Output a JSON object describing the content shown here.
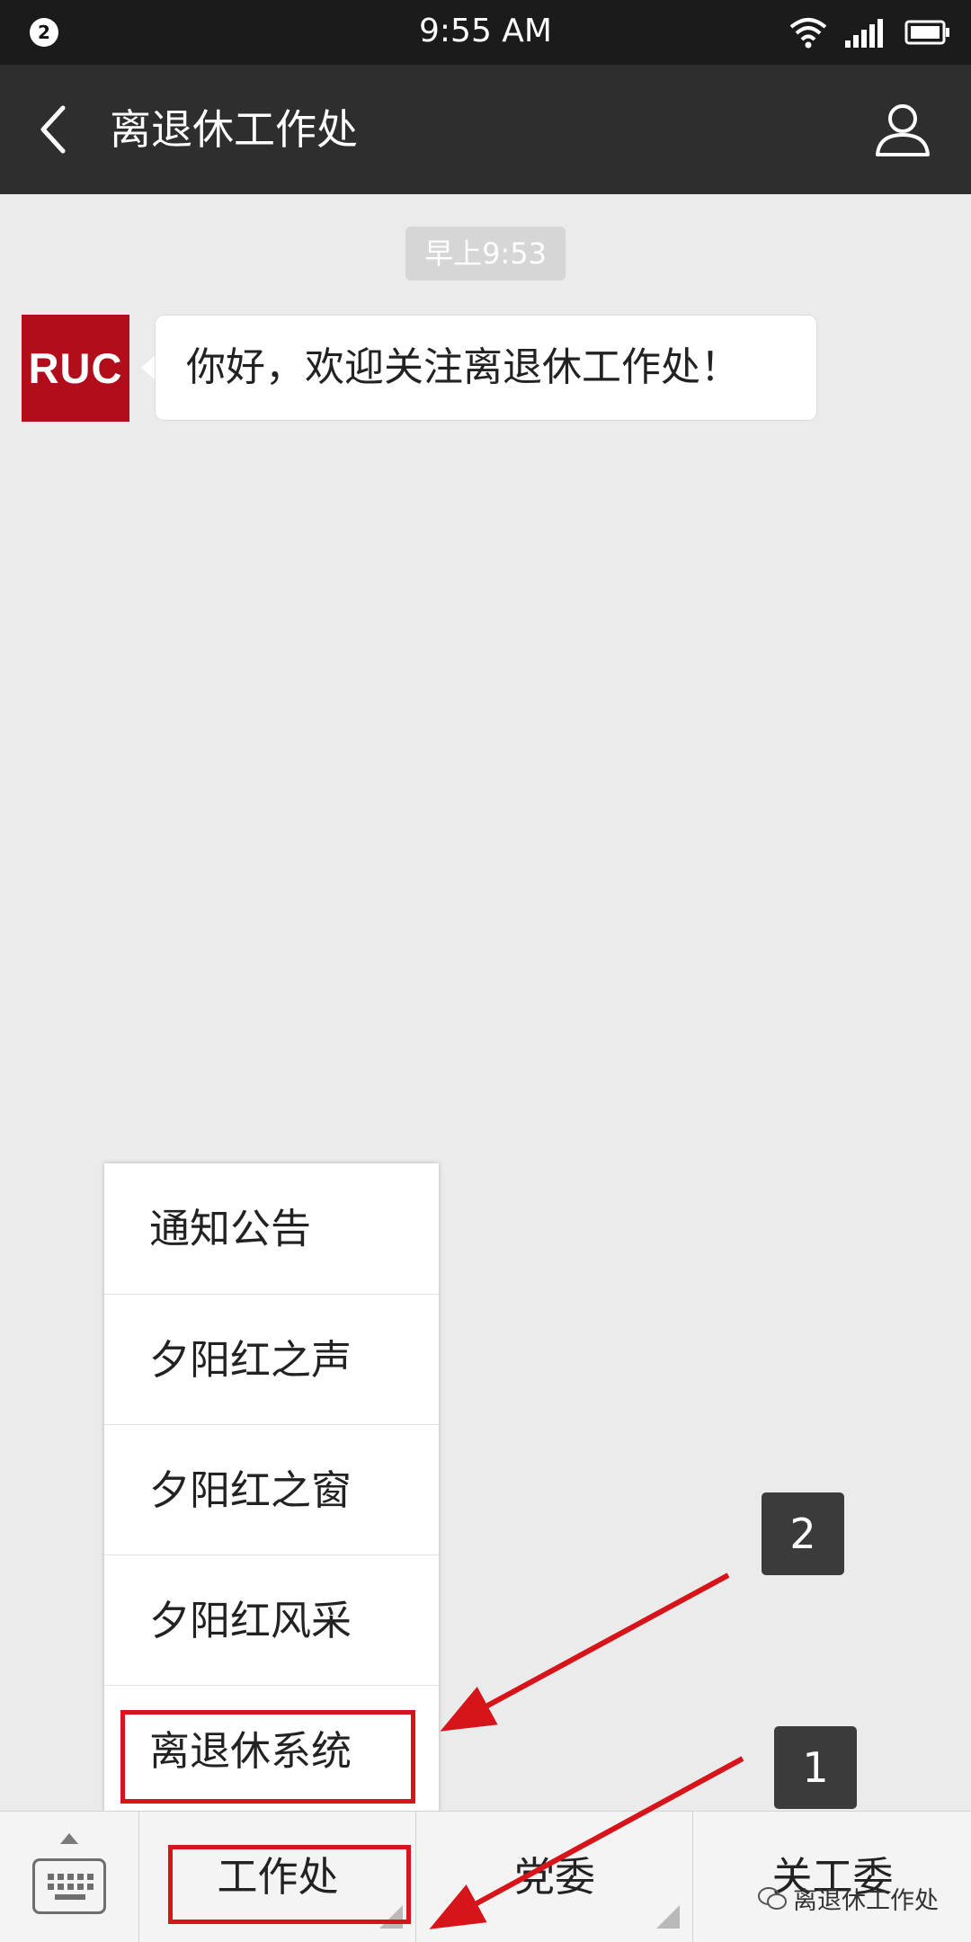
{
  "status_bar": {
    "notification_count": "2",
    "time": "9:55 AM",
    "icons": [
      "wifi-icon",
      "signal-icon",
      "battery-icon"
    ]
  },
  "header": {
    "title": "离退休工作处",
    "back_icon": "chevron-left-icon",
    "profile_icon": "person-icon"
  },
  "chat": {
    "timestamp": "早上9:53",
    "messages": [
      {
        "avatar_text": "RUC",
        "text": "你好，欢迎关注离退休工作处！"
      }
    ]
  },
  "popup_menu": {
    "items": [
      {
        "label": "通知公告"
      },
      {
        "label": "夕阳红之声"
      },
      {
        "label": "夕阳红之窗"
      },
      {
        "label": "夕阳红风采"
      },
      {
        "label": "离退休系统"
      }
    ]
  },
  "bottom_menu": {
    "keyboard_icon": "keyboard-icon",
    "tabs": [
      {
        "label": "工作处"
      },
      {
        "label": "党委"
      },
      {
        "label": "关工委"
      }
    ]
  },
  "annotations": {
    "labels": [
      "1",
      "2"
    ],
    "color": "#d8141b"
  },
  "watermark": {
    "text": "离退休工作处"
  },
  "colors": {
    "status_bar": "#1b1b1b",
    "title_bar": "#2e2e2e",
    "chat_background": "#ebebeb",
    "avatar": "#b10d1a"
  }
}
